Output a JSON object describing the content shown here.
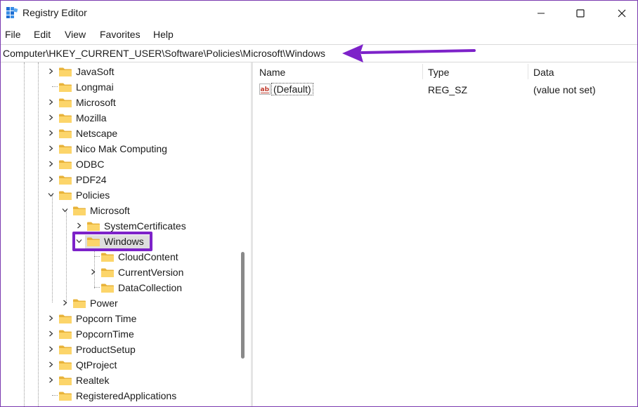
{
  "window": {
    "title": "Registry Editor",
    "icon": "registry-icon"
  },
  "menu": [
    "File",
    "Edit",
    "View",
    "Favorites",
    "Help"
  ],
  "address": "Computer\\HKEY_CURRENT_USER\\Software\\Policies\\Microsoft\\Windows",
  "annotation": {
    "arrow_color": "#7d22c9",
    "highlight_color": "#7d22c9"
  },
  "tree": [
    {
      "label": "JavaSoft",
      "chevron": "right"
    },
    {
      "label": "Longmai",
      "chevron": "none"
    },
    {
      "label": "Microsoft",
      "chevron": "right"
    },
    {
      "label": "Mozilla",
      "chevron": "right"
    },
    {
      "label": "Netscape",
      "chevron": "right"
    },
    {
      "label": "Nico Mak Computing",
      "chevron": "right"
    },
    {
      "label": "ODBC",
      "chevron": "right"
    },
    {
      "label": "PDF24",
      "chevron": "right"
    },
    {
      "label": "Policies",
      "chevron": "down"
    },
    {
      "label": "Microsoft",
      "chevron": "down"
    },
    {
      "label": "SystemCertificates",
      "chevron": "right"
    },
    {
      "label": "Windows",
      "chevron": "down",
      "selected": true
    },
    {
      "label": "CloudContent",
      "chevron": "none"
    },
    {
      "label": "CurrentVersion",
      "chevron": "right"
    },
    {
      "label": "DataCollection",
      "chevron": "none"
    },
    {
      "label": "Power",
      "chevron": "right"
    },
    {
      "label": "Popcorn Time",
      "chevron": "right"
    },
    {
      "label": "PopcornTime",
      "chevron": "right"
    },
    {
      "label": "ProductSetup",
      "chevron": "right"
    },
    {
      "label": "QtProject",
      "chevron": "right"
    },
    {
      "label": "Realtek",
      "chevron": "right"
    },
    {
      "label": "RegisteredApplications",
      "chevron": "none"
    }
  ],
  "columns": {
    "name": "Name",
    "type": "Type",
    "data": "Data"
  },
  "values": [
    {
      "name": "(Default)",
      "type": "REG_SZ",
      "data": "(value not set)",
      "icon": "string-value-icon"
    }
  ]
}
